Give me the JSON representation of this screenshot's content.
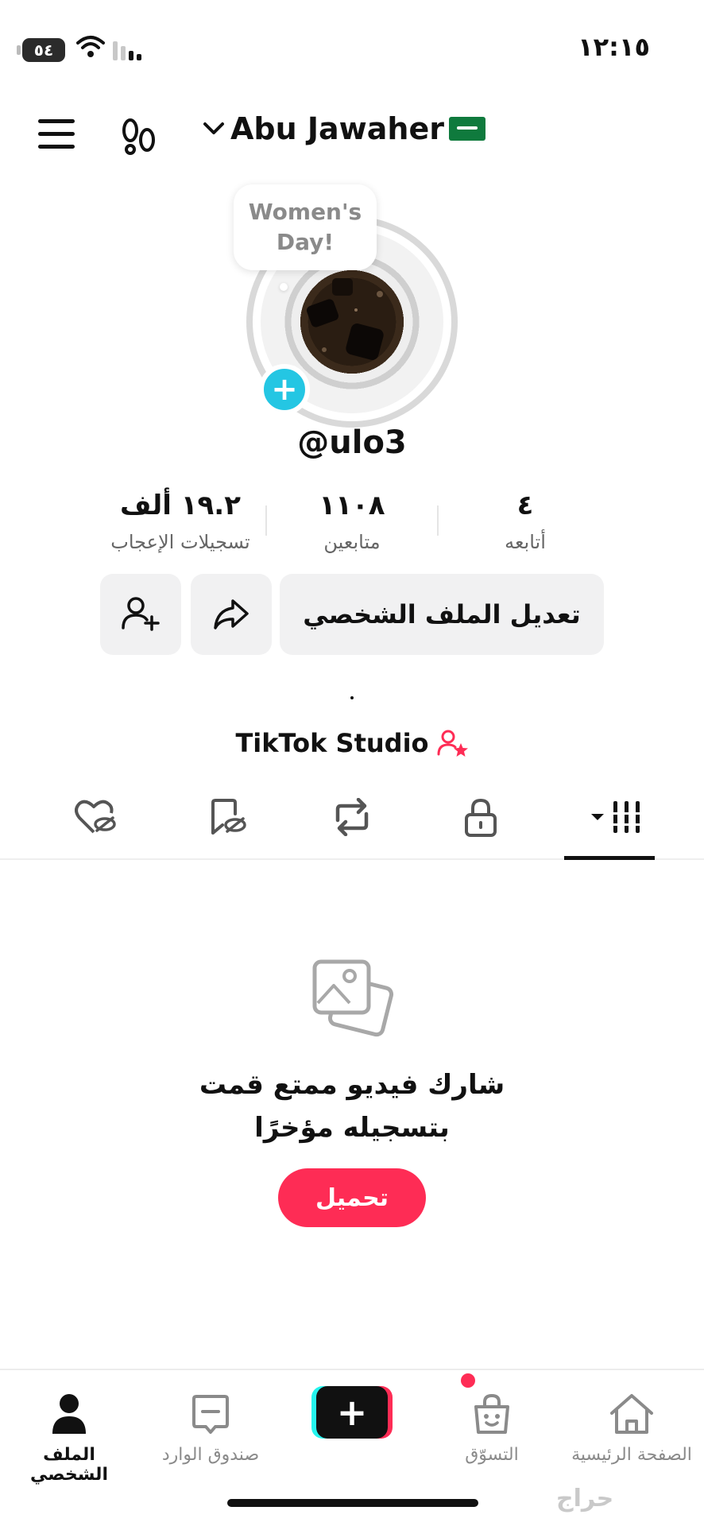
{
  "status_bar": {
    "time": "١٢:١٥",
    "battery": "٥٤"
  },
  "header": {
    "account_name": "Abu Jawaher"
  },
  "profile": {
    "bubble_text": "Women's Day!",
    "username": "@ulo3",
    "stats": [
      {
        "value": "١٩.٢ ألف",
        "label": "تسجيلات الإعجاب"
      },
      {
        "value": "١١٠٨",
        "label": "متابعين"
      },
      {
        "value": "٤",
        "label": "أتابعه"
      }
    ],
    "edit_label": "تعديل الملف الشخصي",
    "studio_label": "TikTok Studio"
  },
  "empty_state": {
    "line1": "شارك فيديو ممتع قمت",
    "line2": "بتسجيله مؤخرًا",
    "upload_label": "تحميل"
  },
  "bottom_nav": {
    "profile": "الملف الشخصي",
    "inbox": "صندوق الوارد",
    "shop": "التسوّق",
    "home": "الصفحة الرئيسية"
  },
  "watermark": "حراج",
  "colors": {
    "accent": "#fe2c55",
    "cyan": "#25f4ee",
    "avatar_add": "#24c6e3"
  }
}
